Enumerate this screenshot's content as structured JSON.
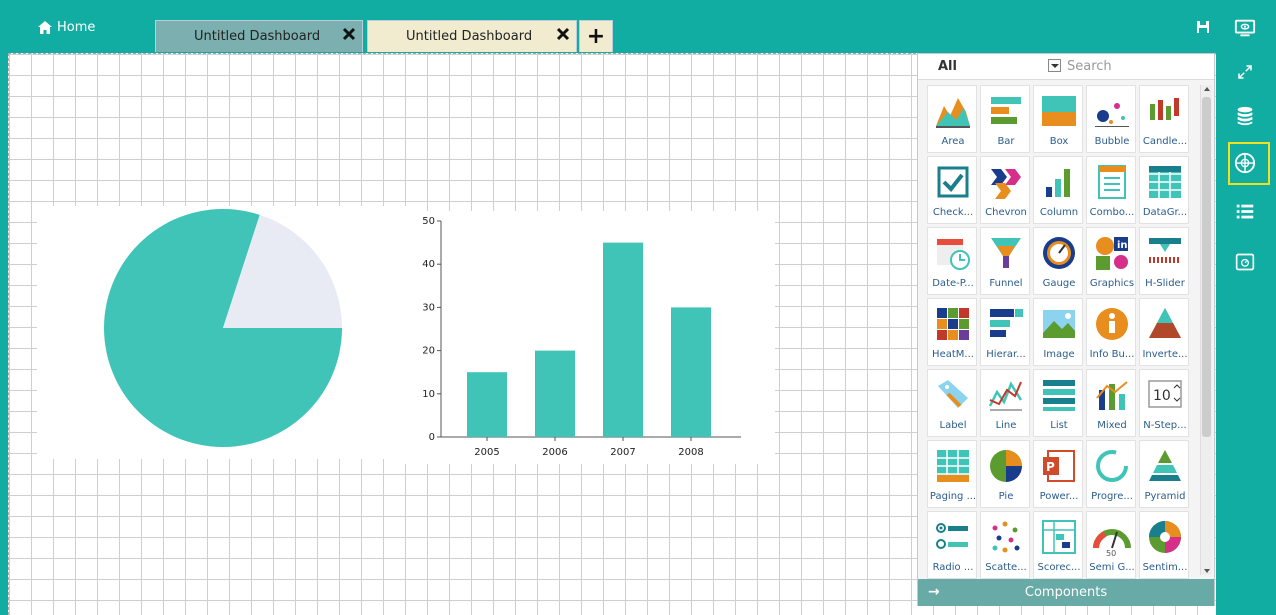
{
  "header": {
    "home_label": "Home",
    "tabs": [
      {
        "label": "Untitled Dashboard",
        "active": false
      },
      {
        "label": "Untitled Dashboard",
        "active": true
      }
    ],
    "add_tab_label": "+"
  },
  "panel": {
    "filter_label": "All",
    "search_placeholder": "Search",
    "footer_label": "Components",
    "footer_arrow": "→",
    "components": [
      "Area",
      "Bar",
      "Box",
      "Bubble",
      "Candle...",
      "Check...",
      "Chevron",
      "Column",
      "Combo...",
      "DataGr...",
      "Date-P...",
      "Funnel",
      "Gauge",
      "Graphics",
      "H-Slider",
      "HeatM...",
      "Hierar...",
      "Image",
      "Info Bu...",
      "Inverte...",
      "Label",
      "Line",
      "List",
      "Mixed",
      "N-Step...",
      "Paging ...",
      "Pie",
      "Power...",
      "Progre...",
      "Pyramid",
      "Radio ...",
      "Scatte...",
      "Scorec...",
      "Semi G...",
      "Sentim..."
    ]
  },
  "colors": {
    "accent": "#11ada3",
    "series": "#40c4b7",
    "pie_other": "#e8ebf4"
  },
  "chart_data": [
    {
      "type": "pie",
      "values": [
        80,
        20
      ]
    },
    {
      "type": "bar",
      "categories": [
        "2005",
        "2006",
        "2007",
        "2008"
      ],
      "values": [
        15,
        20,
        45,
        30
      ],
      "ylim": [
        0,
        50
      ],
      "yticks": [
        0,
        10,
        20,
        30,
        40,
        50
      ],
      "grid": false
    }
  ]
}
